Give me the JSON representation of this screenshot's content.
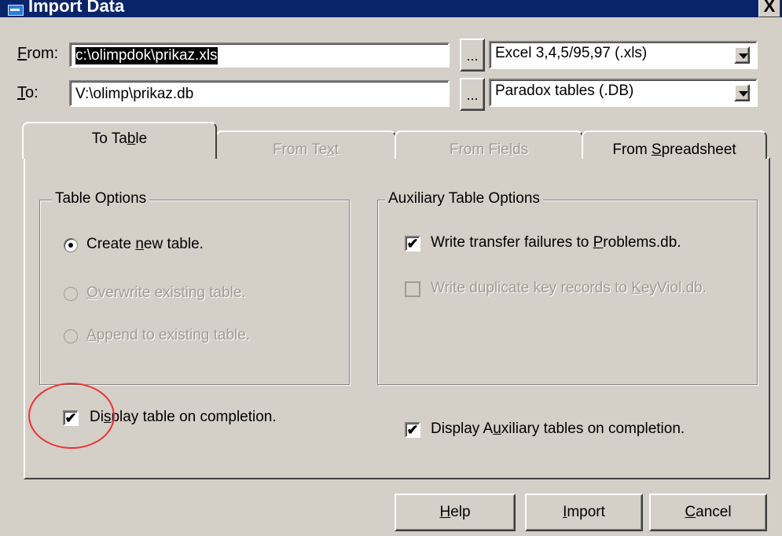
{
  "window": {
    "title": "Import Data",
    "close_label": "X"
  },
  "from": {
    "label_pre": "",
    "label_u": "F",
    "label_post": "rom:",
    "value": "c:\\olimpdok\\prikaz.xls",
    "browse_label": "...",
    "format": "Excel 3,4,5/95,97 (.xls)"
  },
  "to": {
    "label_pre": "",
    "label_u": "T",
    "label_post": "o:",
    "value": "V:\\olimp\\prikaz.db",
    "browse_label": "...",
    "format": "Paradox tables (.DB)"
  },
  "tabs": [
    {
      "pre": "To Ta",
      "u": "b",
      "post": "le",
      "state": "active"
    },
    {
      "pre": "From Te",
      "u": "x",
      "post": "t",
      "state": "disabled"
    },
    {
      "pre": "From Fie",
      "u": "l",
      "post": "ds",
      "state": "disabled"
    },
    {
      "pre": "From ",
      "u": "S",
      "post": "preadsheet",
      "state": "normal"
    }
  ],
  "table_options": {
    "title": "Table Options",
    "options": [
      {
        "pre": "Create ",
        "u": "n",
        "post": "ew table.",
        "checked": true,
        "enabled": true
      },
      {
        "pre": "",
        "u": "O",
        "post": "verwrite existing table.",
        "checked": false,
        "enabled": false
      },
      {
        "pre": "",
        "u": "A",
        "post": "ppend to existing table.",
        "checked": false,
        "enabled": false
      }
    ]
  },
  "aux_options": {
    "title": "Auxiliary Table Options",
    "options": [
      {
        "pre": "Write transfer failures to ",
        "u": "P",
        "post": "roblems.db.",
        "checked": true,
        "enabled": true
      },
      {
        "pre": "Write duplicate key records to ",
        "u": "K",
        "post": "eyViol.db.",
        "checked": false,
        "enabled": false
      }
    ]
  },
  "display_table": {
    "pre": "Di",
    "u": "s",
    "post": "play table on completion.",
    "checked": true
  },
  "display_aux": {
    "pre": "Display A",
    "u": "u",
    "post": "xiliary tables on completion.",
    "checked": true
  },
  "buttons": {
    "help": {
      "pre": "",
      "u": "H",
      "post": "elp"
    },
    "import": {
      "pre": "",
      "u": "I",
      "post": "mport"
    },
    "cancel": {
      "pre": "",
      "u": "C",
      "post": "ancel"
    }
  },
  "colors": {
    "title_bar": "#0a246a",
    "face": "#d4d0c8",
    "annotation": "#e33333"
  }
}
